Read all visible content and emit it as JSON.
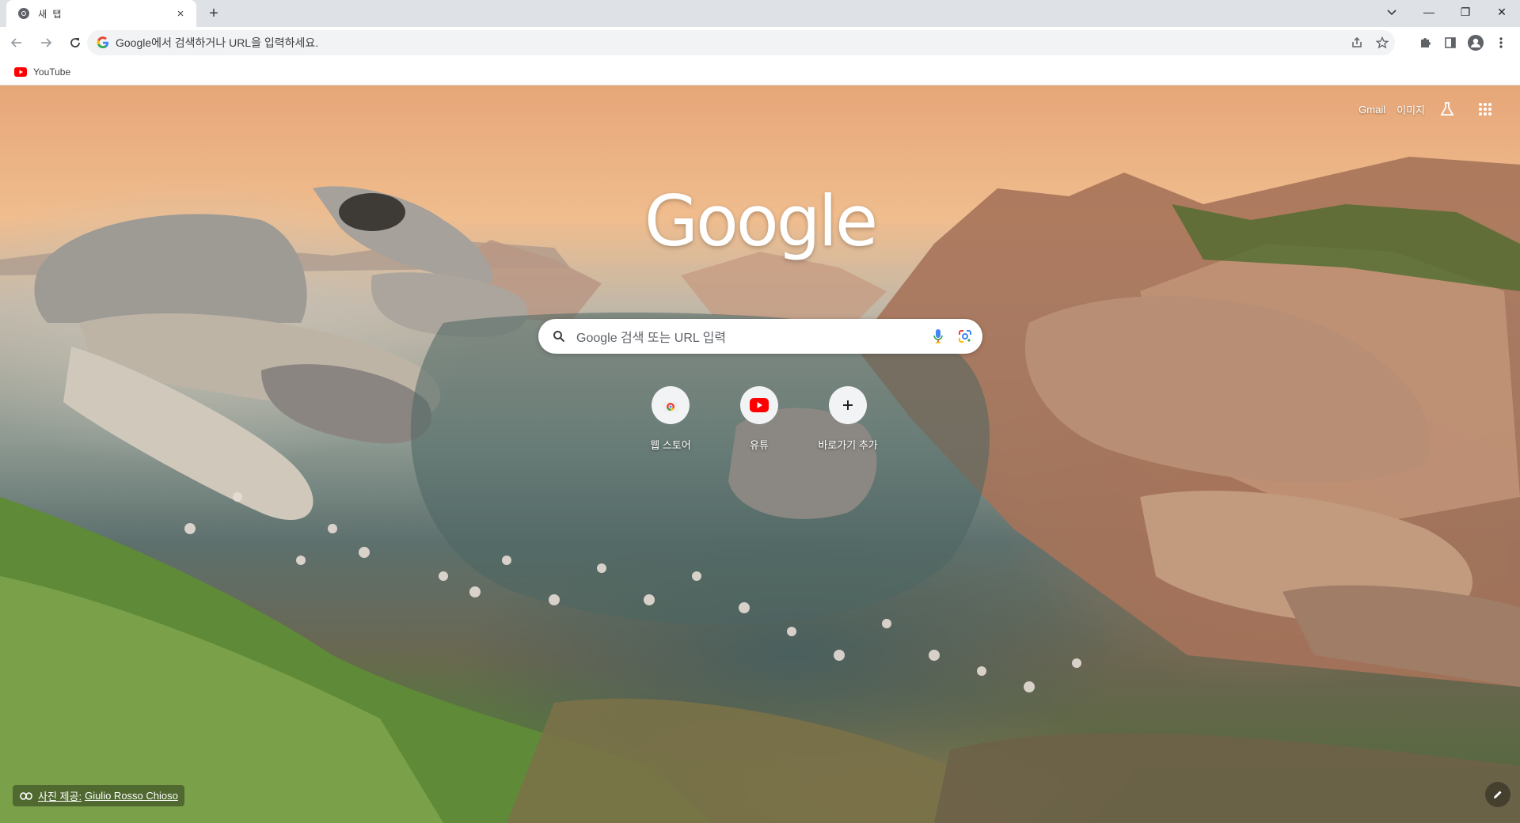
{
  "tab": {
    "title": "새 탭",
    "favicon": "chrome-icon",
    "close": "×"
  },
  "tabstrip": {
    "new_tab": "+"
  },
  "window": {
    "minimize": "—",
    "maximize": "❐",
    "close": "✕"
  },
  "omnibox": {
    "placeholder": "Google에서 검색하거나 URL을 입력하세요."
  },
  "bookmarks": [
    {
      "label": "YouTube",
      "icon": "youtube-icon"
    }
  ],
  "ntp": {
    "links": {
      "gmail": "Gmail",
      "images": "이미지"
    },
    "logo": "Google",
    "search_placeholder": "Google 검색 또는 URL 입력",
    "shortcuts": [
      {
        "label": "웹 스토어",
        "icon": "chrome-web-store-icon"
      },
      {
        "label": "유튜",
        "icon": "youtube-icon"
      },
      {
        "label": "바로가기 추가",
        "icon": "plus-icon"
      }
    ],
    "attribution": {
      "prefix": "사진 제공:",
      "author": "Giulio Rosso Chioso"
    }
  },
  "colors": {
    "tabstrip": "#dee1e6",
    "toolbar": "#ffffff",
    "omnibox": "#f1f3f4",
    "youtube_red": "#ff0000"
  }
}
